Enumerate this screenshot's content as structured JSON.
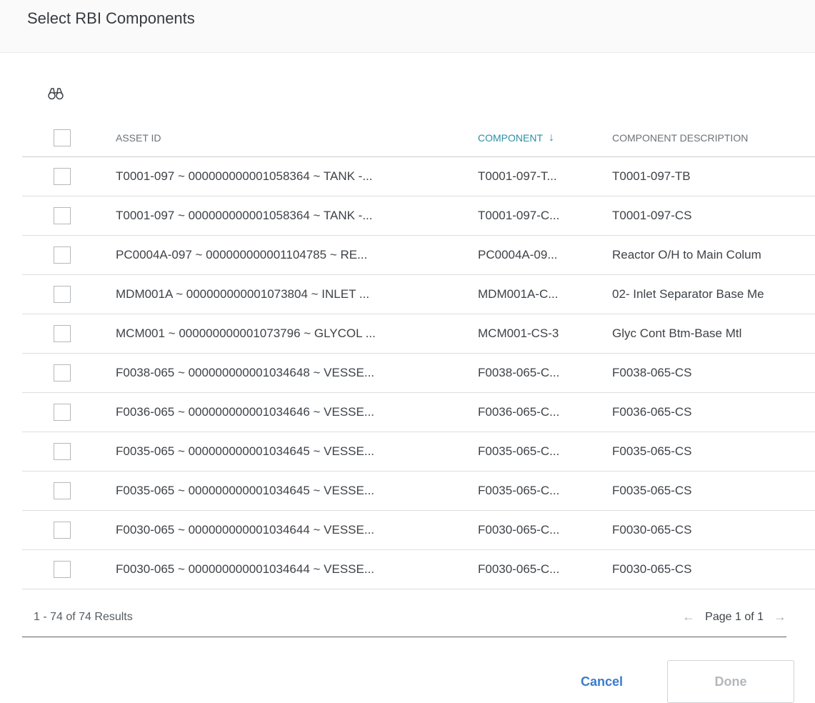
{
  "dialog": {
    "title": "Select RBI Components"
  },
  "toolbar": {
    "search_icon": "binoculars-icon"
  },
  "table": {
    "columns": {
      "asset_id": "ASSET ID",
      "component": "COMPONENT",
      "component_sort_indicator": "↓",
      "component_description": "COMPONENT DESCRIPTION"
    },
    "rows": [
      {
        "asset_id": "T0001-097 ~ 000000000001058364 ~ TANK -...",
        "component": "T0001-097-T...",
        "description": "T0001-097-TB"
      },
      {
        "asset_id": "T0001-097 ~ 000000000001058364 ~ TANK -...",
        "component": "T0001-097-C...",
        "description": "T0001-097-CS"
      },
      {
        "asset_id": "PC0004A-097 ~ 000000000001104785 ~ RE...",
        "component": "PC0004A-09...",
        "description": "Reactor O/H to Main Colum"
      },
      {
        "asset_id": "MDM001A ~ 000000000001073804 ~ INLET ...",
        "component": "MDM001A-C...",
        "description": "02- Inlet Separator Base Me"
      },
      {
        "asset_id": "MCM001 ~ 000000000001073796 ~ GLYCOL ...",
        "component": "MCM001-CS-3",
        "description": "Glyc Cont Btm-Base Mtl"
      },
      {
        "asset_id": "F0038-065 ~ 000000000001034648 ~ VESSE...",
        "component": "F0038-065-C...",
        "description": "F0038-065-CS"
      },
      {
        "asset_id": "F0036-065 ~ 000000000001034646 ~ VESSE...",
        "component": "F0036-065-C...",
        "description": "F0036-065-CS"
      },
      {
        "asset_id": "F0035-065 ~ 000000000001034645 ~ VESSE...",
        "component": "F0035-065-C...",
        "description": "F0035-065-CS"
      },
      {
        "asset_id": "F0035-065 ~ 000000000001034645 ~ VESSE...",
        "component": "F0035-065-C...",
        "description": "F0035-065-CS"
      },
      {
        "asset_id": "F0030-065 ~ 000000000001034644 ~ VESSE...",
        "component": "F0030-065-C...",
        "description": "F0030-065-CS"
      },
      {
        "asset_id": "F0030-065 ~ 000000000001034644 ~ VESSE...",
        "component": "F0030-065-C...",
        "description": "F0030-065-CS"
      }
    ]
  },
  "footer": {
    "results_text": "1 - 74 of 74 Results",
    "page_text": "Page 1 of 1",
    "prev_icon": "←",
    "next_icon": "→"
  },
  "actions": {
    "cancel_label": "Cancel",
    "done_label": "Done"
  },
  "colors": {
    "accent": "#2e8fa4",
    "link": "#3b7bc8",
    "disabled": "#b3b8bc"
  }
}
